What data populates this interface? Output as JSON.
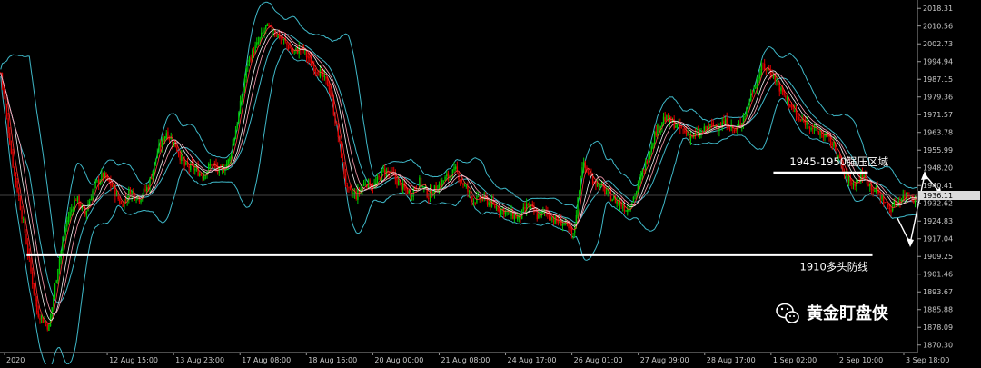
{
  "chart_data": {
    "type": "candlestick",
    "colors": {
      "background": "#000000",
      "bull_candle": "#00c800",
      "bear_candle": "#e00000",
      "bollinger": "#3fb8c8",
      "ma_fast": "#ff4040",
      "ma_slow": "#ffa0b4",
      "ma_mid": "#f2f2f2",
      "support_line": "#ffffff",
      "axis_text": "#c8c8c8"
    },
    "x_axis": {
      "tick_labels": [
        "2020",
        "12 Aug 15:00",
        "13 Aug 23:00",
        "17 Aug 08:00",
        "18 Aug 16:00",
        "20 Aug 00:00",
        "21 Aug 08:00",
        "24 Aug 17:00",
        "26 Aug 01:00",
        "27 Aug 09:00",
        "28 Aug 17:00",
        "1 Sep 02:00",
        "2 Sep 10:00",
        "3 Sep 18:00"
      ]
    },
    "y_axis": {
      "tick_labels": [
        "2018.31",
        "2010.56",
        "2002.73",
        "1994.94",
        "1987.15",
        "1979.36",
        "1971.57",
        "1963.78",
        "1955.99",
        "1948.20",
        "1940.41",
        "1932.62",
        "1924.83",
        "1917.04",
        "1909.25",
        "1901.46",
        "1893.67",
        "1885.88",
        "1878.09",
        "1870.30"
      ],
      "ylim": [
        1867.0,
        2022.0
      ],
      "current_price": "1936.11"
    },
    "price_path": [
      [
        0,
        1990
      ],
      [
        8,
        1950
      ],
      [
        16,
        1920
      ],
      [
        24,
        1885
      ],
      [
        32,
        1878
      ],
      [
        38,
        1905
      ],
      [
        44,
        1925
      ],
      [
        50,
        1935
      ],
      [
        56,
        1928
      ],
      [
        62,
        1940
      ],
      [
        68,
        1945
      ],
      [
        74,
        1940
      ],
      [
        80,
        1932
      ],
      [
        86,
        1938
      ],
      [
        92,
        1935
      ],
      [
        98,
        1940
      ],
      [
        104,
        1955
      ],
      [
        110,
        1964
      ],
      [
        116,
        1958
      ],
      [
        122,
        1949
      ],
      [
        128,
        1948
      ],
      [
        134,
        1945
      ],
      [
        140,
        1950
      ],
      [
        146,
        1946
      ],
      [
        152,
        1952
      ],
      [
        158,
        1972
      ],
      [
        164,
        1995
      ],
      [
        170,
        2002
      ],
      [
        176,
        2010
      ],
      [
        182,
        2008
      ],
      [
        188,
        2004
      ],
      [
        194,
        1999
      ],
      [
        200,
        2001
      ],
      [
        206,
        1994
      ],
      [
        212,
        1990
      ],
      [
        218,
        1984
      ],
      [
        224,
        1962
      ],
      [
        230,
        1938
      ],
      [
        236,
        1936
      ],
      [
        242,
        1942
      ],
      [
        248,
        1940
      ],
      [
        254,
        1947
      ],
      [
        260,
        1945
      ],
      [
        266,
        1940
      ],
      [
        272,
        1937
      ],
      [
        278,
        1942
      ],
      [
        284,
        1936
      ],
      [
        290,
        1940
      ],
      [
        296,
        1944
      ],
      [
        302,
        1947
      ],
      [
        308,
        1940
      ],
      [
        314,
        1934
      ],
      [
        320,
        1935
      ],
      [
        326,
        1932
      ],
      [
        332,
        1930
      ],
      [
        338,
        1928
      ],
      [
        344,
        1926
      ],
      [
        350,
        1932
      ],
      [
        356,
        1927
      ],
      [
        362,
        1929
      ],
      [
        368,
        1925
      ],
      [
        374,
        1924
      ],
      [
        380,
        1918
      ],
      [
        386,
        1950
      ],
      [
        392,
        1944
      ],
      [
        398,
        1940
      ],
      [
        404,
        1936
      ],
      [
        410,
        1933
      ],
      [
        416,
        1930
      ],
      [
        422,
        1938
      ],
      [
        428,
        1950
      ],
      [
        434,
        1963
      ],
      [
        440,
        1970
      ],
      [
        446,
        1968
      ],
      [
        452,
        1965
      ],
      [
        458,
        1962
      ],
      [
        464,
        1963
      ],
      [
        470,
        1966
      ],
      [
        476,
        1967
      ],
      [
        482,
        1968
      ],
      [
        488,
        1964
      ],
      [
        494,
        1972
      ],
      [
        500,
        1984
      ],
      [
        506,
        1993
      ],
      [
        512,
        1990
      ],
      [
        518,
        1982
      ],
      [
        524,
        1976
      ],
      [
        530,
        1969
      ],
      [
        536,
        1968
      ],
      [
        542,
        1964
      ],
      [
        548,
        1962
      ],
      [
        554,
        1957
      ],
      [
        560,
        1945
      ],
      [
        566,
        1941
      ],
      [
        572,
        1945
      ],
      [
        578,
        1940
      ],
      [
        584,
        1936
      ],
      [
        590,
        1930
      ],
      [
        596,
        1934
      ],
      [
        602,
        1937
      ],
      [
        608,
        1934
      ]
    ],
    "annotations": [
      {
        "label": "1945-1950强压区域",
        "price": 1946.0,
        "span": [
          0.843,
          0.946
        ]
      },
      {
        "label": "1910多头防线",
        "price": 1910.0,
        "span": [
          0.029,
          0.951
        ]
      }
    ],
    "watermark": "黄金盯盘侠",
    "watermark_icon": "wechat-icon"
  }
}
